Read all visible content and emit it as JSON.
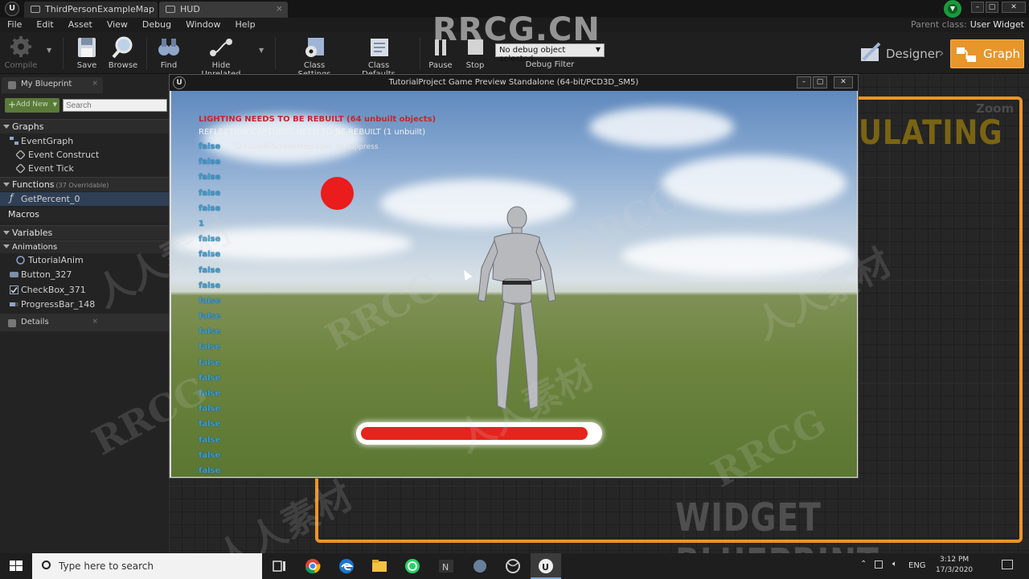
{
  "tabs": [
    {
      "label": "ThirdPersonExampleMap",
      "active": false
    },
    {
      "label": "HUD",
      "active": true
    }
  ],
  "menu": [
    "File",
    "Edit",
    "Asset",
    "View",
    "Debug",
    "Window",
    "Help"
  ],
  "parent_class": {
    "label": "Parent class:",
    "value": "User Widget"
  },
  "toolbar": {
    "compile": "Compile",
    "save": "Save",
    "browse": "Browse",
    "find": "Find",
    "hide_unrelated": "Hide Unrelated",
    "class_settings": "Class Settings",
    "class_defaults": "Class Defaults",
    "pause": "Pause",
    "stop": "Stop",
    "debug_object": "No debug object selected",
    "debug_filter": "Debug Filter"
  },
  "modes": {
    "designer": "Designer",
    "graph": "Graph"
  },
  "left_panel": {
    "my_blueprint_tab": "My Blueprint",
    "add_new": "Add New",
    "search_placeholder": "Search",
    "graphs_header": "Graphs",
    "event_graph": "EventGraph",
    "event_construct": "Event Construct",
    "event_tick": "Event Tick",
    "functions_header": "Functions",
    "functions_overridable": "(37 Overridable)",
    "get_percent": "GetPercent_0",
    "macros_header": "Macros",
    "variables_header": "Variables",
    "animations_header": "Animations",
    "tutorial_anim": "TutorialAnim",
    "button_var": "Button_327",
    "checkbox_var": "CheckBox_371",
    "progressbar_var": "ProgressBar_148",
    "details_tab": "Details"
  },
  "graph_area": {
    "zoom_label": "Zoom",
    "simulating": "ULATING",
    "widget_blueprint": "WIDGET BLUEPRINT"
  },
  "game_window": {
    "title": "TutorialProject Game Preview Standalone (64-bit/PCD3D_SM5)",
    "lighting_warning": "LIGHTING NEEDS TO BE REBUILT (64 unbuilt objects)",
    "reflection_warning": "REFLECTION CAPTURES NEED TO BE REBUILT (1 unbuilt)",
    "disable_msg": "'DisableAllScreenMessages' to suppress",
    "debug_lines": [
      "false",
      "false",
      "false",
      "false",
      "false",
      "1",
      "false",
      "false",
      "false",
      "false",
      "false",
      "false",
      "false",
      "false",
      "false",
      "false",
      "false",
      "false",
      "false",
      "false",
      "false",
      "false"
    ],
    "progress_percent": 96
  },
  "taskbar": {
    "search_placeholder": "Type here to search",
    "language": "ENG",
    "time": "3:12 PM",
    "date": "17/3/2020"
  },
  "watermark": {
    "top": "RRCG.CN",
    "tile": "RRCG",
    "cn": "人人素材"
  },
  "colors": {
    "accent_orange": "#ef9325",
    "graph_button": "#e8952a",
    "progress_fill": "#e5241c",
    "ball": "#ea1c1c",
    "debug_text": "#3c9fd4",
    "warning_red": "#c8262b"
  }
}
